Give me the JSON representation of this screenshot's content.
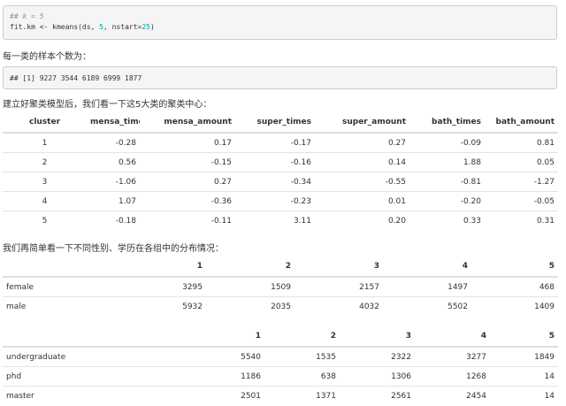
{
  "code1": {
    "comment": "## k = 5",
    "prefix": "fit.km ",
    "arrow": "<-",
    "middle": " kmeans(ds, ",
    "k": "5",
    "sep": ", nstart=",
    "nstart": "25",
    "close": ")"
  },
  "text1": "每一类的样本个数为：",
  "code2": {
    "output": "## [1] 9227 3544 6189 6999 1877"
  },
  "text2": "建立好聚类模型后，我们看一下这5大类的聚类中心：",
  "cluster_table": {
    "headers": [
      "cluster",
      "mensa_times",
      "mensa_amount",
      "super_times",
      "super_amount",
      "bath_times",
      "bath_amount"
    ],
    "rows": [
      [
        "1",
        "-0.28",
        "0.17",
        "-0.17",
        "0.27",
        "-0.09",
        "0.81"
      ],
      [
        "2",
        "0.56",
        "-0.15",
        "-0.16",
        "0.14",
        "1.88",
        "0.05"
      ],
      [
        "3",
        "-1.06",
        "0.27",
        "-0.34",
        "-0.55",
        "-0.81",
        "-1.27"
      ],
      [
        "4",
        "1.07",
        "-0.36",
        "-0.23",
        "0.01",
        "-0.20",
        "-0.05"
      ],
      [
        "5",
        "-0.18",
        "-0.11",
        "3.11",
        "0.20",
        "0.33",
        "0.31"
      ]
    ]
  },
  "text3": "我们再简单看一下不同性别、学历在各组中的分布情况：",
  "gender_table": {
    "headers": [
      "",
      "1",
      "2",
      "3",
      "4",
      "5"
    ],
    "rows": [
      [
        "female",
        "3295",
        "1509",
        "2157",
        "1497",
        "468"
      ],
      [
        "male",
        "5932",
        "2035",
        "4032",
        "5502",
        "1409"
      ]
    ]
  },
  "edu_table": {
    "headers": [
      "",
      "1",
      "2",
      "3",
      "4",
      "5"
    ],
    "rows": [
      [
        "undergraduate",
        "5540",
        "1535",
        "2322",
        "3277",
        "1849"
      ],
      [
        "phd",
        "1186",
        "638",
        "1306",
        "1268",
        "14"
      ],
      [
        "master",
        "2501",
        "1371",
        "2561",
        "2454",
        "14"
      ]
    ]
  }
}
